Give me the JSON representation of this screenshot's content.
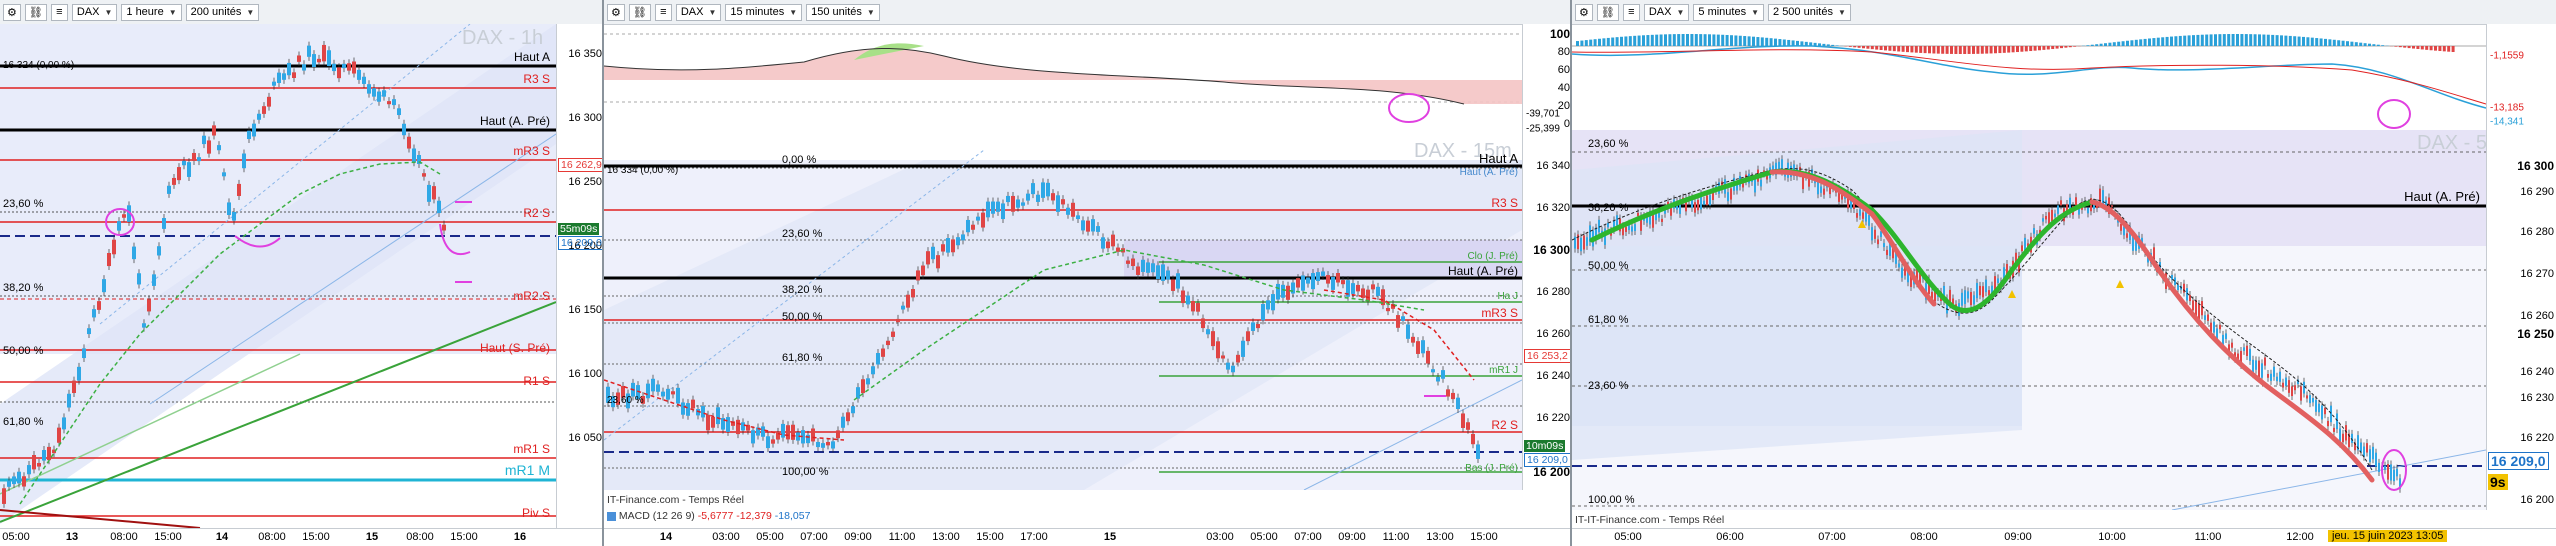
{
  "panels": [
    {
      "id": "p1",
      "symbol": "DAX",
      "timeframe": "1 heure",
      "units": "200 unités",
      "watermark": "DAX - 1h",
      "top_readout": "16 324 (0,00 %)",
      "y_ticks": [
        "16 350",
        "16 300",
        "16 250",
        "16 200",
        "16 150",
        "16 100",
        "16 050"
      ],
      "price_tags": [
        {
          "text": "16 262,9",
          "color": "#e53935"
        },
        {
          "text": "55m09s",
          "color": "#1b7a2e"
        },
        {
          "text": "16 209,0",
          "color": "#1e73c8"
        }
      ],
      "x_labels": [
        {
          "t": "05:00",
          "b": false
        },
        {
          "t": "13",
          "b": true
        },
        {
          "t": "08:00",
          "b": false
        },
        {
          "t": "15:00",
          "b": false
        },
        {
          "t": "14",
          "b": true
        },
        {
          "t": "08:00",
          "b": false
        },
        {
          "t": "15:00",
          "b": false
        },
        {
          "t": "15",
          "b": true
        },
        {
          "t": "08:00",
          "b": false
        },
        {
          "t": "15:00",
          "b": false
        },
        {
          "t": "16",
          "b": true
        }
      ],
      "levels": [
        "Haut A",
        "R3 S",
        "Haut (A. Pré)",
        "mR3 S",
        "R2 S",
        "mR2 S",
        "Haut (S. Pré)",
        "R1 S",
        "mR1 S",
        "mR1 M",
        "Piv S"
      ],
      "fibs": [
        "23,60 %",
        "38,20 %",
        "50,00 %",
        "61,80 %"
      ]
    },
    {
      "id": "p2",
      "symbol": "DAX",
      "timeframe": "15 minutes",
      "units": "150 unités",
      "watermark": "DAX - 15m",
      "top_readout": "16 334 (0,00 %)",
      "osc_ticks": [
        "100",
        "80",
        "60",
        "40",
        "20",
        "0"
      ],
      "osc_values": [
        "-39,701",
        "-25,399"
      ],
      "y_ticks": [
        "16 340",
        "16 320",
        "16 300",
        "16 280",
        "16 260",
        "16 240",
        "16 220",
        "16 200"
      ],
      "price_tags": [
        {
          "text": "16 253,2",
          "color": "#e53935"
        },
        {
          "text": "10m09s",
          "color": "#1b7a2e"
        },
        {
          "text": "16 209,0",
          "color": "#1e73c8"
        }
      ],
      "x_labels": [
        {
          "t": "14",
          "b": true
        },
        {
          "t": "03:00",
          "b": false
        },
        {
          "t": "05:00",
          "b": false
        },
        {
          "t": "07:00",
          "b": false
        },
        {
          "t": "09:00",
          "b": false
        },
        {
          "t": "11:00",
          "b": false
        },
        {
          "t": "13:00",
          "b": false
        },
        {
          "t": "15:00",
          "b": false
        },
        {
          "t": "17:00",
          "b": false
        },
        {
          "t": "15",
          "b": true
        },
        {
          "t": "03:00",
          "b": false
        },
        {
          "t": "05:00",
          "b": false
        },
        {
          "t": "07:00",
          "b": false
        },
        {
          "t": "09:00",
          "b": false
        },
        {
          "t": "11:00",
          "b": false
        },
        {
          "t": "13:00",
          "b": false
        },
        {
          "t": "15:00",
          "b": false
        }
      ],
      "levels": [
        "Haut A",
        "Haut (A. Pré)",
        "R3 S",
        "Clo (J. Pré)",
        "Haut (A. Pré)",
        "Ha J",
        "mR3 S",
        "mR1 J",
        "R2 S",
        "Bas (J. Pré)"
      ],
      "fibs": [
        "0,00 %",
        "23,60 %",
        "38,20 %",
        "50,00 %",
        "61,80 %",
        "23,60 %",
        "100,00 %"
      ],
      "footer": "IT-Finance.com - Temps Réel",
      "macd_label": "MACD (12 26 9)",
      "macd_values": [
        "-5,6777",
        "-12,379",
        "-18,057"
      ]
    },
    {
      "id": "p3",
      "symbol": "DAX",
      "timeframe": "5 minutes",
      "units": "2 500 unités",
      "watermark": "DAX - 5m",
      "osc_values": [
        "-1,1559",
        "-13,185",
        "-14,341"
      ],
      "y_ticks": [
        "16 300",
        "16 290",
        "16 280",
        "16 270",
        "16 260",
        "16 250",
        "16 240",
        "16 230",
        "16 220",
        "16 200"
      ],
      "price_tag": "16 209,0",
      "countdown": "9s",
      "x_labels": [
        "05:00",
        "06:00",
        "07:00",
        "08:00",
        "09:00",
        "10:00",
        "11:00",
        "12:00"
      ],
      "date_badge": "jeu. 15 juin 2023 13:05",
      "levels": [
        "Haut (A. Pré)"
      ],
      "fibs": [
        "23,60 %",
        "38,20 %",
        "50,00 %",
        "61,80 %",
        "23,60 %",
        "100,00 %"
      ],
      "footer": "IT-IT-Finance.com - Temps Réel"
    }
  ]
}
